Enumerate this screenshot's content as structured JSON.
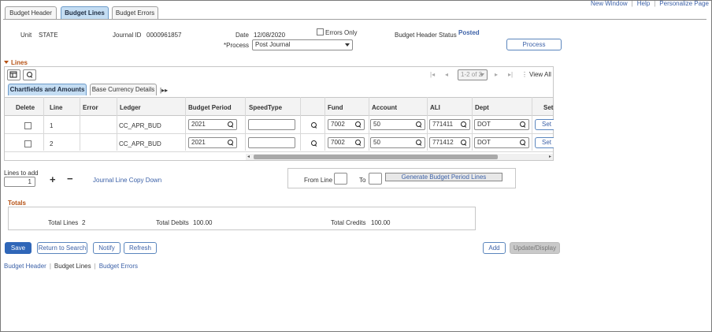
{
  "top_links": [
    "New Window",
    "Help",
    "Personalize Page"
  ],
  "page_tabs": [
    "Budget Header",
    "Budget Lines",
    "Budget Errors"
  ],
  "header": {
    "unit_label": "Unit",
    "unit_value": "STATE",
    "journal_id_label": "Journal ID",
    "journal_id_value": "0000961857",
    "date_label": "Date",
    "date_value": "12/08/2020",
    "errors_only_label": "Errors Only",
    "errors_only_checked": false,
    "budget_header_status_label": "Budget Header Status",
    "budget_header_status_value": "Posted",
    "process_label": "*Process",
    "process_value": "Post Journal",
    "process_button": "Process"
  },
  "lines": {
    "section_title": "Lines",
    "pagination": "1-2 of 2",
    "view_all": "View All",
    "tabs": [
      "Chartfields and Amounts",
      "Base Currency Details"
    ],
    "columns": [
      "Delete",
      "Line",
      "Error",
      "Ledger",
      "Budget Period",
      "SpeedType",
      "",
      "Fund",
      "Account",
      "ALI",
      "Dept",
      "Set"
    ],
    "rows": [
      {
        "line": "1",
        "error": "",
        "ledger": "CC_APR_BUD",
        "budget_period": "2021",
        "speedtype": "",
        "fund": "7002",
        "account": "50",
        "ali": "771411",
        "dept": "DOT",
        "set": "Set"
      },
      {
        "line": "2",
        "error": "",
        "ledger": "CC_APR_BUD",
        "budget_period": "2021",
        "speedtype": "",
        "fund": "7002",
        "account": "50",
        "ali": "771412",
        "dept": "DOT",
        "set": "Set"
      }
    ]
  },
  "add_lines": {
    "lines_to_add_label": "Lines to add",
    "lines_to_add_value": "1",
    "copy_down_link": "Journal Line Copy Down",
    "from_line_label": "From Line",
    "to_label": "To",
    "generate_button": "Generate Budget Period Lines"
  },
  "totals": {
    "section_title": "Totals",
    "total_lines_label": "Total Lines",
    "total_lines_value": "2",
    "total_debits_label": "Total Debits",
    "total_debits_value": "100.00",
    "total_credits_label": "Total Credits",
    "total_credits_value": "100.00"
  },
  "actions": {
    "save": "Save",
    "return_to_search": "Return to Search",
    "notify": "Notify",
    "refresh": "Refresh",
    "add": "Add",
    "update_display": "Update/Display"
  },
  "bottom_links": [
    "Budget Header",
    "Budget Lines",
    "Budget Errors"
  ],
  "colors": {
    "section_title": "#b65215",
    "link": "#3d62a8",
    "primary_button": "#2f66b8",
    "active_tab": "#c4ddf3"
  }
}
